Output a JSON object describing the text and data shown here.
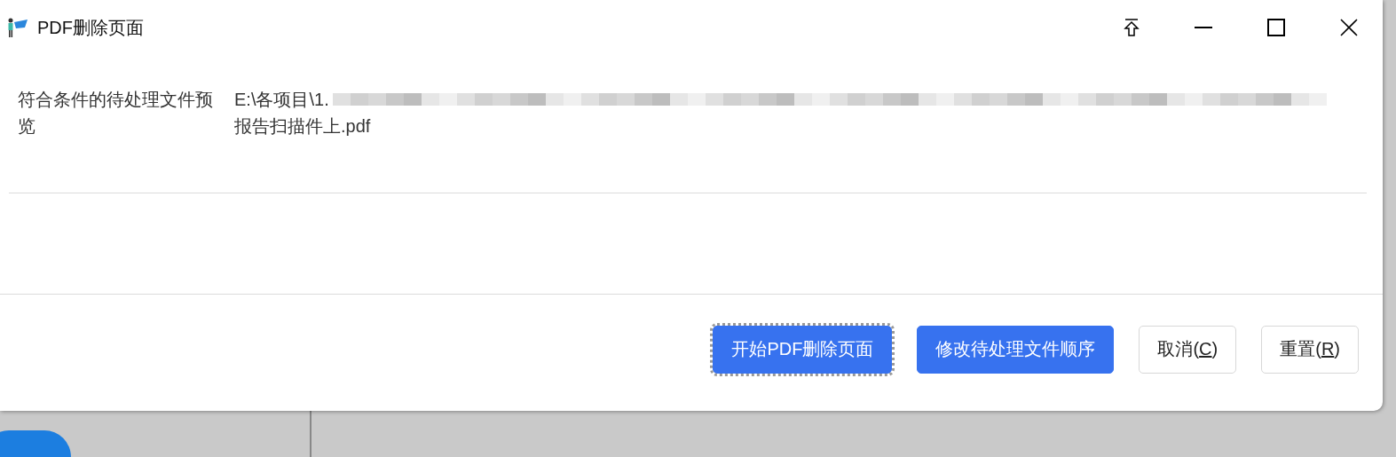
{
  "window": {
    "title": "PDF删除页面"
  },
  "preview": {
    "label": "符合条件的待处理文件预览",
    "path_start": "E:\\各项目\\1.",
    "path_end": "报告扫描件上.pdf"
  },
  "buttons": [
    {
      "kind": "primary",
      "label": "开始PDF删除页面",
      "focused": true
    },
    {
      "kind": "primary",
      "label": "修改待处理文件顺序",
      "focused": false
    },
    {
      "kind": "plain",
      "label": "取消(",
      "key": "C",
      "after": ")",
      "focused": false
    },
    {
      "kind": "plain",
      "label": "重置(",
      "key": "R",
      "after": ")",
      "focused": false
    }
  ]
}
